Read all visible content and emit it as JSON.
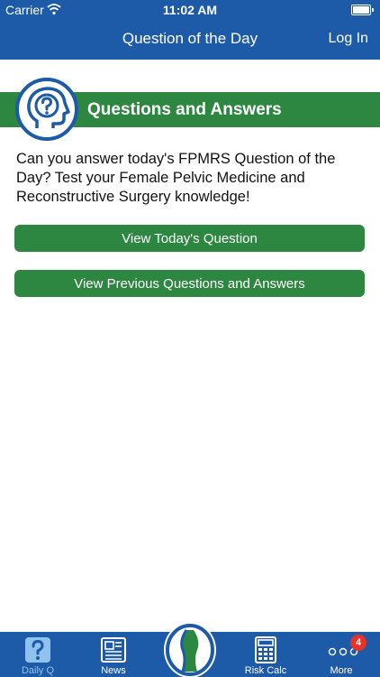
{
  "status_bar": {
    "carrier": "Carrier",
    "time": "11:02 AM"
  },
  "nav": {
    "title": "Question of the Day",
    "login_label": "Log In"
  },
  "section": {
    "title": "Questions and Answers",
    "icon": "head-question-icon"
  },
  "intro_text": "Can you answer today's FPMRS Question of the Day?  Test your Female Pelvic Medicine and Reconstructive Surgery knowledge!",
  "buttons": {
    "today": "View Today's Question",
    "previous": "View Previous Questions and Answers"
  },
  "tabs": [
    {
      "label": "Daily Q",
      "icon": "question-icon",
      "active": true
    },
    {
      "label": "News",
      "icon": "newspaper-icon",
      "active": false
    },
    {
      "label": "",
      "icon": "logo-icon",
      "active": false
    },
    {
      "label": "Risk Calc",
      "icon": "calculator-icon",
      "active": false
    },
    {
      "label": "More",
      "icon": "more-dots-icon",
      "active": false,
      "badge": "4"
    }
  ],
  "colors": {
    "brand_blue": "#1d5aa8",
    "brand_green": "#2d8740",
    "active_tab": "#8fc2ee",
    "badge_red": "#e8322b"
  }
}
